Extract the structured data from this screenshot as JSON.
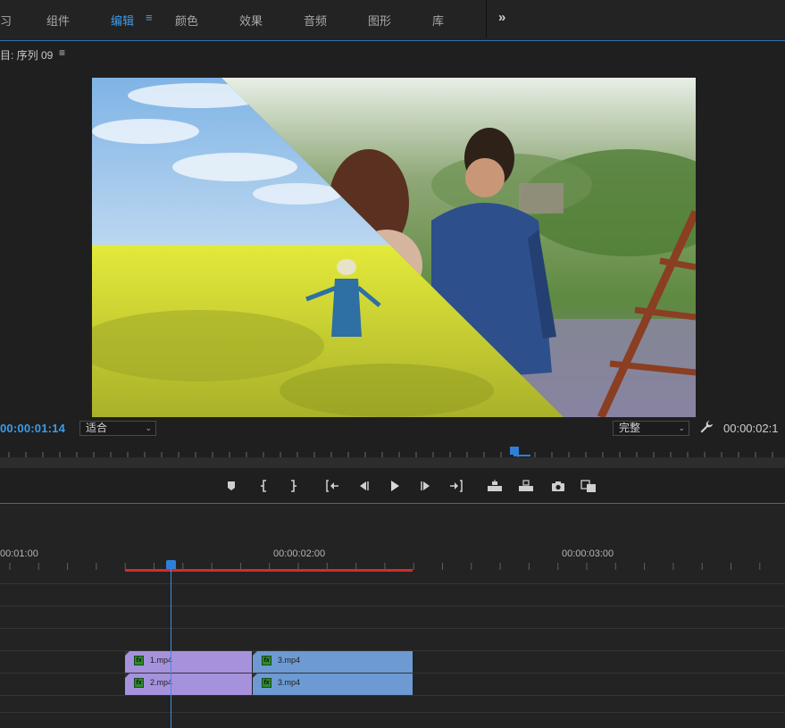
{
  "workspace": {
    "tabs": [
      {
        "label": "习",
        "active": false
      },
      {
        "label": "组件",
        "active": false
      },
      {
        "label": "编辑",
        "active": true
      },
      {
        "label": "颜色",
        "active": false
      },
      {
        "label": "效果",
        "active": false
      },
      {
        "label": "音频",
        "active": false
      },
      {
        "label": "图形",
        "active": false
      },
      {
        "label": "库",
        "active": false
      }
    ],
    "menu_icon": "≡",
    "more_icon": "»"
  },
  "monitor": {
    "title": "目: 序列 09",
    "menu_icon": "≡",
    "current_timecode": "00:00:01:14",
    "duration_timecode": "00:00:02:1",
    "zoom_select": "适合",
    "quality_select": "完整",
    "settings_icon": "wrench-icon"
  },
  "transport": {
    "buttons": [
      "add-marker-icon",
      "mark-in-icon",
      "mark-out-icon",
      "go-to-in-icon",
      "step-back-icon",
      "play-icon",
      "step-forward-icon",
      "go-to-out-icon",
      "lift-icon",
      "extract-icon",
      "export-frame-icon",
      "comparison-view-icon"
    ]
  },
  "timeline": {
    "ruler_labels": [
      "00:01:00",
      "00:00:02:00",
      "00:00:03:00"
    ],
    "clips": [
      {
        "name": "1.mp4",
        "color": "purple",
        "track": "V2"
      },
      {
        "name": "3.mp4",
        "color": "blue",
        "track": "V2"
      },
      {
        "name": "2.mp4",
        "color": "purple",
        "track": "V1"
      },
      {
        "name": "3.mp4",
        "color": "blue",
        "track": "V1"
      }
    ],
    "fx_label": "fx"
  },
  "colors": {
    "accent": "#3d9be9",
    "work_area": "#d12b2b",
    "clip_purple": "#a692dc",
    "clip_blue": "#6d9ad2"
  }
}
